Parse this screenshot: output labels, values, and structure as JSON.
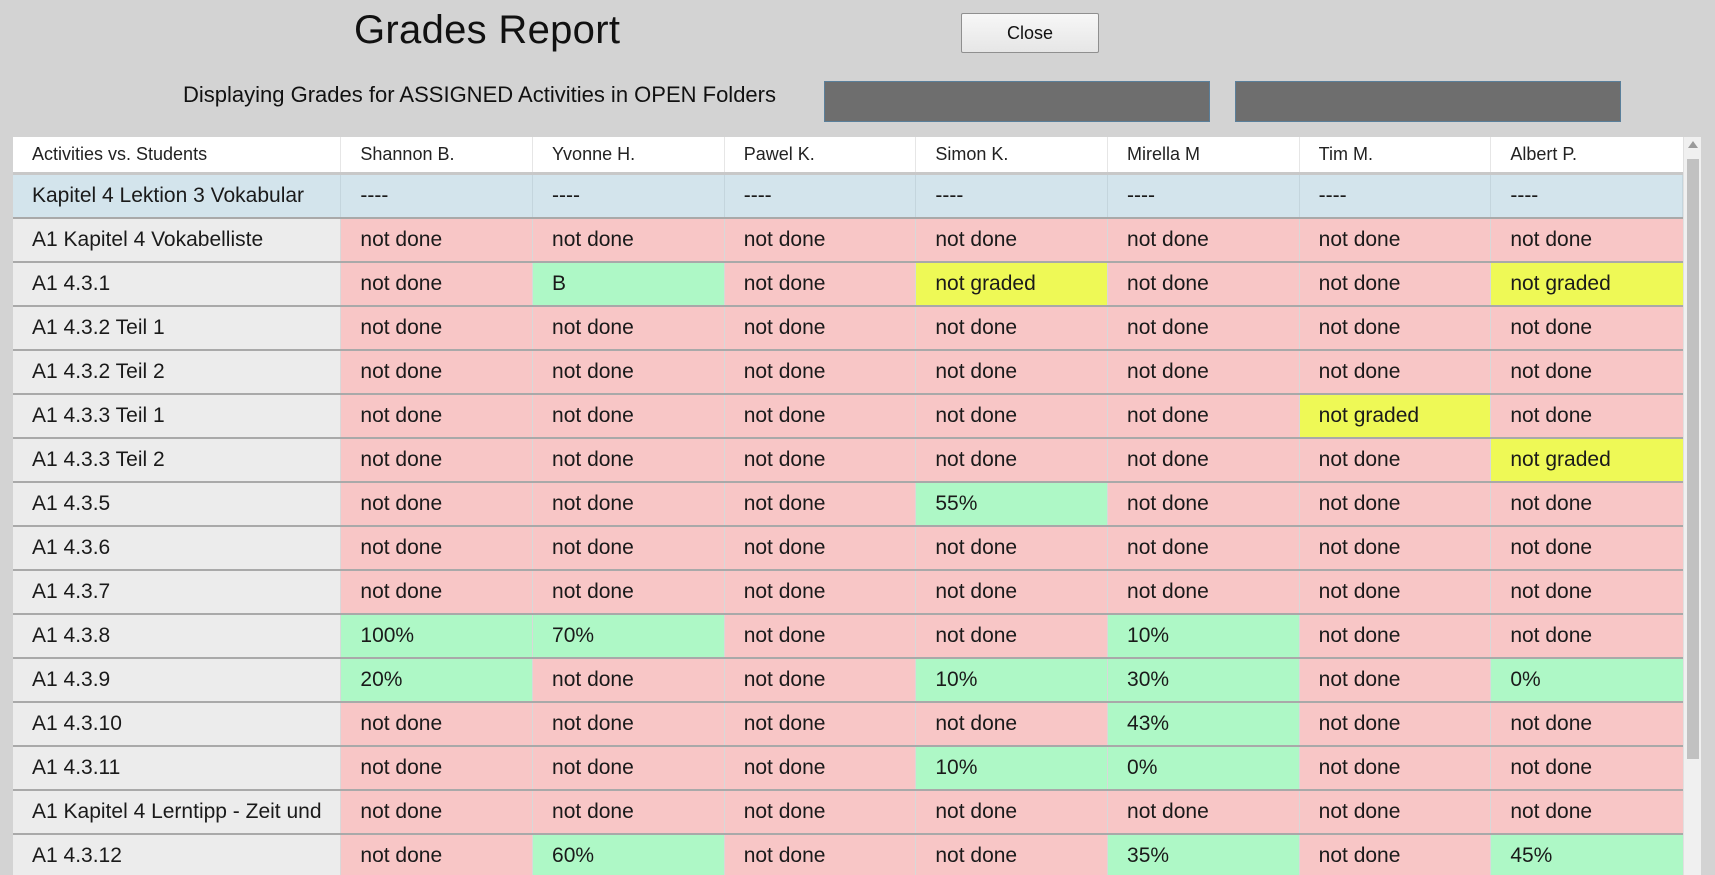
{
  "header": {
    "title": "Grades Report",
    "close_label": "Close",
    "subtitle": "Displaying Grades for ASSIGNED Activities in OPEN Folders"
  },
  "colors": {
    "not_done": "#f8c6c6",
    "not_graded": "#eef956",
    "graded": "#aef8c6",
    "section": "#d3e4ec",
    "activity_cell": "#ececec"
  },
  "table": {
    "corner_label": "Activities vs. Students",
    "students": [
      "Shannon B.",
      "Yvonne H.",
      "Pawel K.",
      "Simon K.",
      "Mirella M",
      "Tim M.",
      "Albert P."
    ],
    "rows": [
      {
        "activity": "Kapitel 4 Lektion 3 Vokabular",
        "section": true,
        "cells": [
          "----",
          "----",
          "----",
          "----",
          "----",
          "----",
          "----"
        ]
      },
      {
        "activity": "A1 Kapitel 4 Vokabelliste",
        "cells": [
          "not done",
          "not done",
          "not done",
          "not done",
          "not done",
          "not done",
          "not done"
        ]
      },
      {
        "activity": "A1 4.3.1",
        "cells": [
          "not done",
          "B",
          "not done",
          "not graded",
          "not done",
          "not done",
          "not graded"
        ]
      },
      {
        "activity": "A1 4.3.2 Teil 1",
        "cells": [
          "not done",
          "not done",
          "not done",
          "not done",
          "not done",
          "not done",
          "not done"
        ]
      },
      {
        "activity": "A1 4.3.2 Teil 2",
        "cells": [
          "not done",
          "not done",
          "not done",
          "not done",
          "not done",
          "not done",
          "not done"
        ]
      },
      {
        "activity": "A1 4.3.3 Teil 1",
        "cells": [
          "not done",
          "not done",
          "not done",
          "not done",
          "not done",
          "not graded",
          "not done"
        ]
      },
      {
        "activity": "A1 4.3.3 Teil 2",
        "cells": [
          "not done",
          "not done",
          "not done",
          "not done",
          "not done",
          "not done",
          "not graded"
        ]
      },
      {
        "activity": "A1 4.3.5",
        "cells": [
          "not done",
          "not done",
          "not done",
          "55%",
          "not done",
          "not done",
          "not done"
        ]
      },
      {
        "activity": "A1 4.3.6",
        "cells": [
          "not done",
          "not done",
          "not done",
          "not done",
          "not done",
          "not done",
          "not done"
        ]
      },
      {
        "activity": "A1 4.3.7",
        "cells": [
          "not done",
          "not done",
          "not done",
          "not done",
          "not done",
          "not done",
          "not done"
        ]
      },
      {
        "activity": "A1 4.3.8",
        "cells": [
          "100%",
          "70%",
          "not done",
          "not done",
          "10%",
          "not done",
          "not done"
        ]
      },
      {
        "activity": "A1 4.3.9",
        "cells": [
          "20%",
          "not done",
          "not done",
          "10%",
          "30%",
          "not done",
          "0%"
        ]
      },
      {
        "activity": "A1 4.3.10",
        "cells": [
          "not done",
          "not done",
          "not done",
          "not done",
          "43%",
          "not done",
          "not done"
        ]
      },
      {
        "activity": "A1 4.3.11",
        "cells": [
          "not done",
          "not done",
          "not done",
          "10%",
          "0%",
          "not done",
          "not done"
        ]
      },
      {
        "activity": "A1 Kapitel 4 Lerntipp - Zeit und",
        "cells": [
          "not done",
          "not done",
          "not done",
          "not done",
          "not done",
          "not done",
          "not done"
        ]
      },
      {
        "activity": "A1 4.3.12",
        "cells": [
          "not done",
          "60%",
          "not done",
          "not done",
          "35%",
          "not done",
          "45%"
        ]
      }
    ]
  }
}
